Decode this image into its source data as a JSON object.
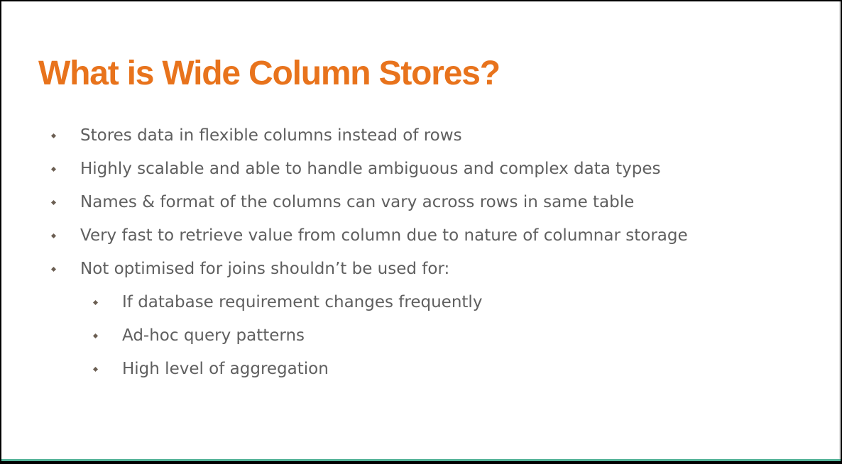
{
  "slide": {
    "title": "What is Wide Column Stores?",
    "bullets": [
      {
        "level": 1,
        "text": "Stores data in flexible columns instead of rows"
      },
      {
        "level": 1,
        "text": "Highly scalable and able to handle ambiguous and complex data types"
      },
      {
        "level": 1,
        "text": "Names & format of the columns can vary across rows in same table"
      },
      {
        "level": 1,
        "text": "Very fast to retrieve value from column due to nature of columnar storage"
      },
      {
        "level": 1,
        "text": "Not optimised for joins shouldn’t be used for:"
      },
      {
        "level": 2,
        "text": "If database requirement changes frequently"
      },
      {
        "level": 2,
        "text": "Ad-hoc query patterns"
      },
      {
        "level": 2,
        "text": "High level of aggregation"
      }
    ]
  },
  "colors": {
    "title": "#e8731c",
    "body_text": "#5f5f5f",
    "bullet_marker": "#6b5e52",
    "accent_bar": "#56b49a"
  },
  "icons": {
    "bullet_marker": "diamond-bullet-icon"
  }
}
